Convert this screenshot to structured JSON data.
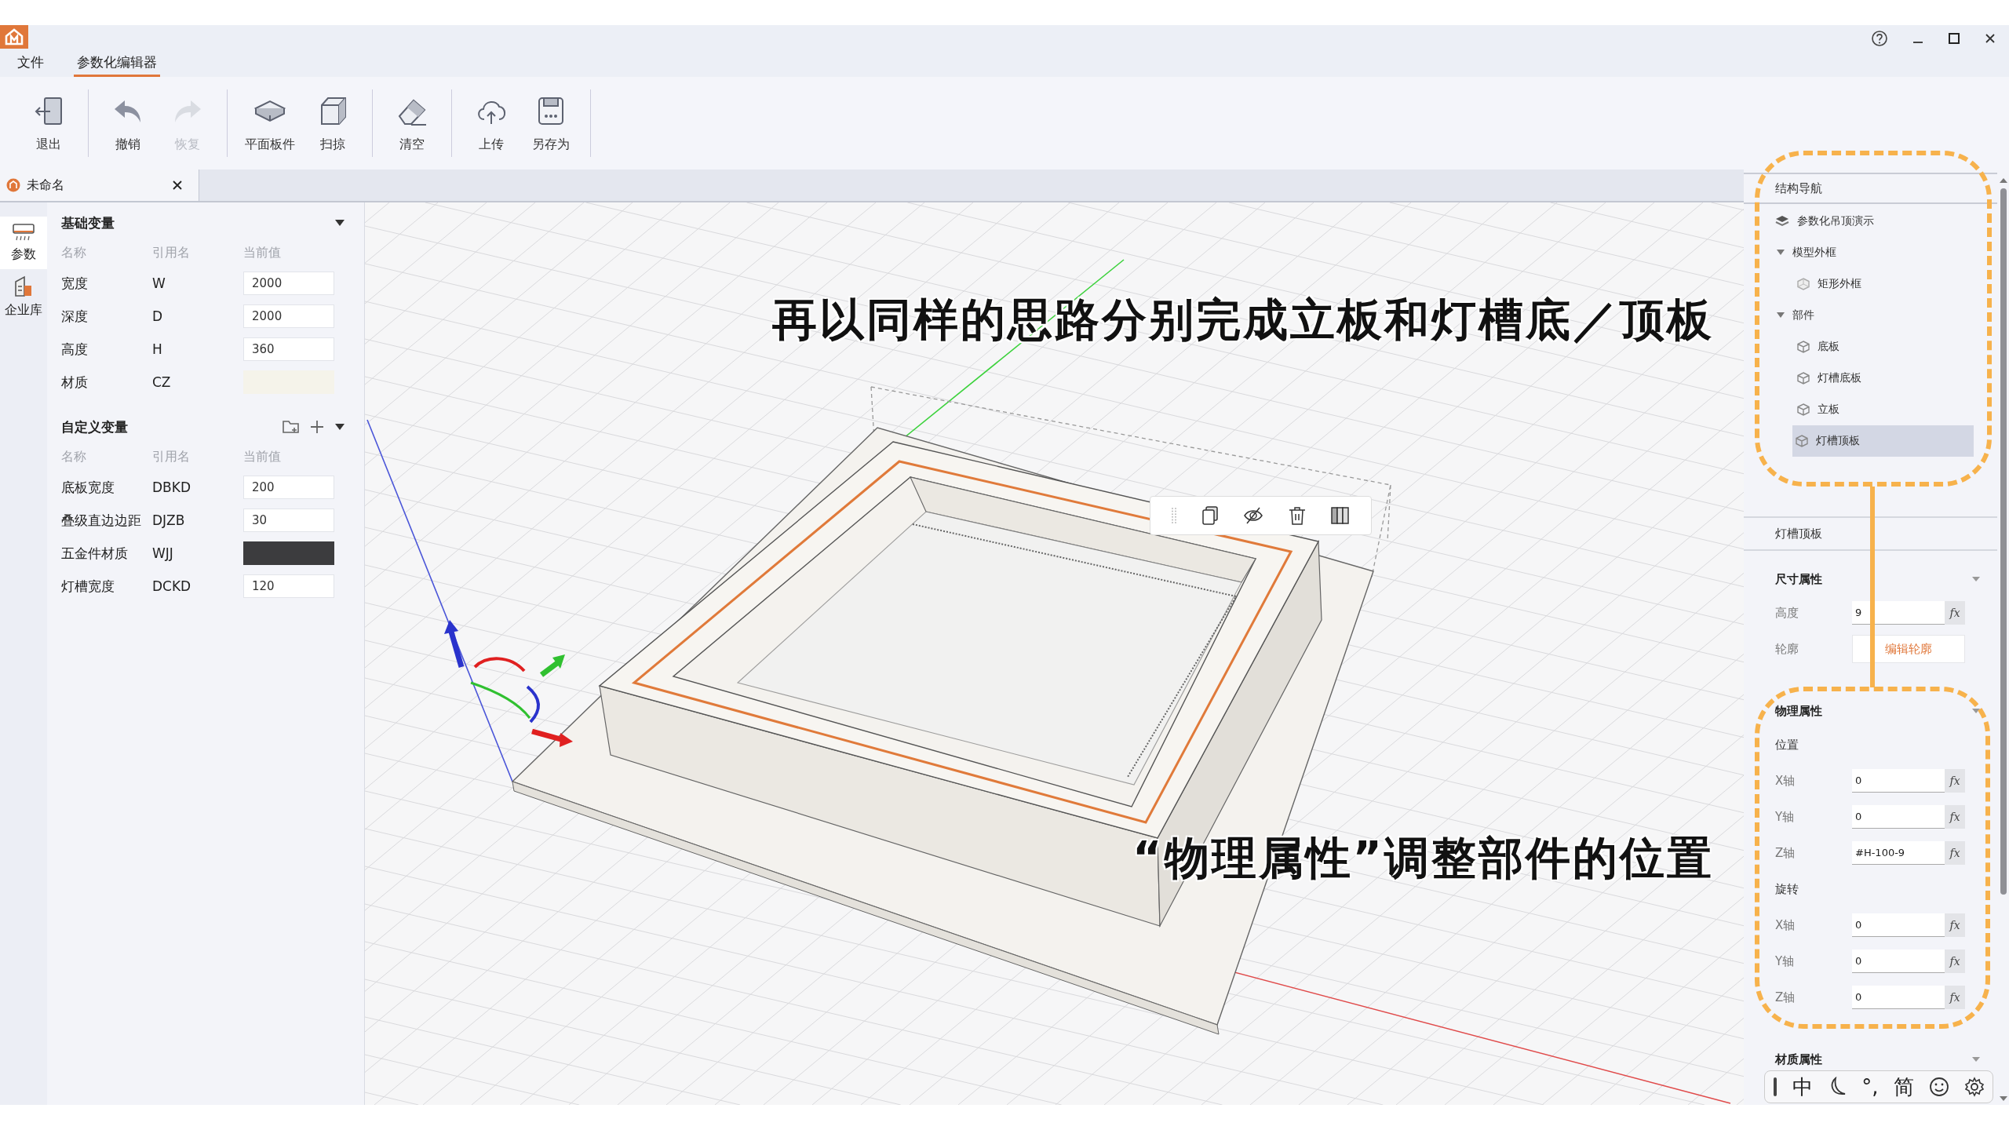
{
  "menu": [
    {
      "label": "文件",
      "selected": false
    },
    {
      "label": "参数化编辑器",
      "selected": true
    }
  ],
  "toolbar": [
    [
      {
        "label": "退出",
        "kind": "exit",
        "disabled": false
      }
    ],
    [
      {
        "label": "撤销",
        "kind": "undo",
        "disabled": false
      },
      {
        "label": "恢复",
        "kind": "redo",
        "disabled": true
      }
    ],
    [
      {
        "label": "平面板件",
        "kind": "board",
        "disabled": false
      },
      {
        "label": "扫掠",
        "kind": "sweep",
        "disabled": false
      }
    ],
    [
      {
        "label": "清空",
        "kind": "erase",
        "disabled": false
      }
    ],
    [
      {
        "label": "上传",
        "kind": "upload",
        "disabled": false
      },
      {
        "label": "另存为",
        "kind": "save",
        "disabled": false
      }
    ]
  ],
  "document_tab": {
    "title": "未命名"
  },
  "side_rail": [
    {
      "label": "参数",
      "kind": "params",
      "selected": true
    },
    {
      "label": "企业库",
      "kind": "library",
      "selected": false
    }
  ],
  "basic_variables": {
    "title": "基础变量",
    "columns": [
      "名称",
      "引用名",
      "当前值"
    ],
    "rows": [
      {
        "name": "宽度",
        "ref": "W",
        "kind": "number",
        "value": "2000"
      },
      {
        "name": "深度",
        "ref": "D",
        "kind": "number",
        "value": "2000"
      },
      {
        "name": "高度",
        "ref": "H",
        "kind": "number",
        "value": "360"
      },
      {
        "name": "材质",
        "ref": "CZ",
        "kind": "swatch",
        "color": "#f5f3ea"
      }
    ]
  },
  "custom_variables": {
    "title": "自定义变量",
    "columns": [
      "名称",
      "引用名",
      "当前值"
    ],
    "rows": [
      {
        "name": "底板宽度",
        "ref": "DBKD",
        "kind": "number",
        "value": "200"
      },
      {
        "name": "叠级直边边距",
        "ref": "DJZB",
        "kind": "number",
        "value": "30"
      },
      {
        "name": "五金件材质",
        "ref": "WJJ",
        "kind": "swatch",
        "color": "#3c3c3e"
      },
      {
        "name": "灯槽宽度",
        "ref": "DCKD",
        "kind": "number",
        "value": "120"
      }
    ]
  },
  "captions": [
    "再以同样的思路分别完成立板和灯槽底／顶板",
    "“物理属性”调整部件的位置"
  ],
  "structure_nav": {
    "title": "结构导航",
    "tree": [
      {
        "label": "参数化吊顶演示",
        "kind": "root",
        "selected": false
      },
      {
        "label": "模型外框",
        "kind": "group",
        "expanded": true,
        "selected": false,
        "children": [
          {
            "label": "矩形外框",
            "kind": "frame",
            "selected": false
          }
        ]
      },
      {
        "label": "部件",
        "kind": "group",
        "expanded": true,
        "selected": false,
        "children": [
          {
            "label": "底板",
            "kind": "part",
            "selected": false
          },
          {
            "label": "灯槽底板",
            "kind": "part",
            "selected": false
          },
          {
            "label": "立板",
            "kind": "part",
            "selected": false
          },
          {
            "label": "灯槽顶板",
            "kind": "part",
            "selected": true
          }
        ]
      }
    ]
  },
  "properties": {
    "title": "灯槽顶板",
    "sections": [
      {
        "title": "尺寸属性",
        "rows": [
          {
            "kind": "field",
            "label": "高度",
            "value": "9",
            "fx": "fx"
          },
          {
            "kind": "button",
            "label": "轮廓",
            "button": "编辑轮廓"
          }
        ]
      },
      {
        "title": "物理属性",
        "rows": [
          {
            "kind": "heading",
            "label": "位置"
          },
          {
            "kind": "field",
            "label": "X轴",
            "value": "0",
            "fx": "fx"
          },
          {
            "kind": "field",
            "label": "Y轴",
            "value": "0",
            "fx": "fx"
          },
          {
            "kind": "field",
            "label": "Z轴",
            "value": "#H-100-9",
            "fx": "fx"
          },
          {
            "kind": "heading",
            "label": "旋转"
          },
          {
            "kind": "field",
            "label": "X轴",
            "value": "0",
            "fx": "fx"
          },
          {
            "kind": "field",
            "label": "Y轴",
            "value": "0",
            "fx": "fx"
          },
          {
            "kind": "field",
            "label": "Z轴",
            "value": "0",
            "fx": "fx"
          }
        ]
      },
      {
        "title": "材质属性"
      }
    ]
  },
  "ime": {
    "mode": "中",
    "punctuation": "°,",
    "charset": "简"
  }
}
